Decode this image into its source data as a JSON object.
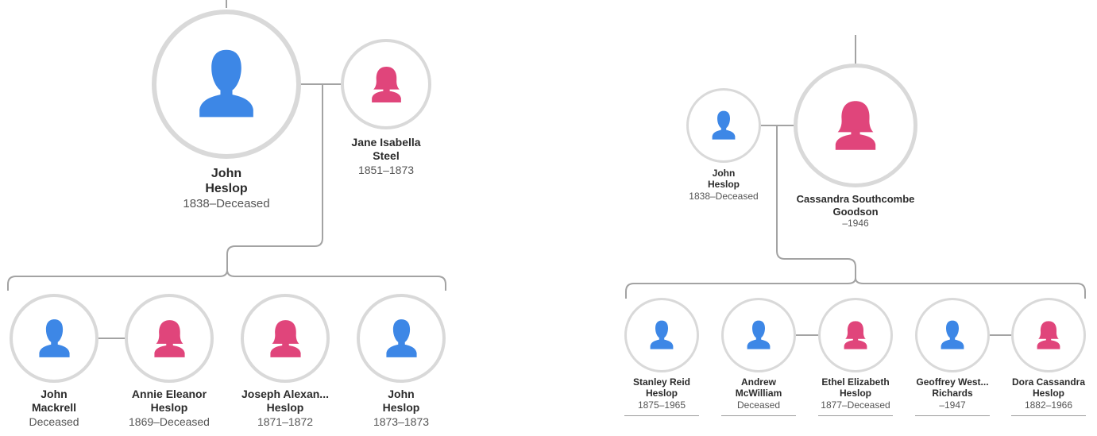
{
  "colors": {
    "male": "#3d87e6",
    "female": "#e0457b",
    "ring": "#d9d9d9",
    "line": "#a3a3a3"
  },
  "left_tree": {
    "father": {
      "first": "John",
      "last": "Heslop",
      "dates": "1838–Deceased",
      "gender": "male",
      "icon": "male-person-icon"
    },
    "mother": {
      "first": "Jane Isabella",
      "last": "Steel",
      "dates": "1851–1873",
      "gender": "female",
      "icon": "female-person-icon"
    },
    "children": [
      {
        "first": "John",
        "last": "Mackrell",
        "dates": "Deceased",
        "gender": "male",
        "icon": "male-person-icon"
      },
      {
        "first": "Annie Eleanor",
        "last": "Heslop",
        "dates": "1869–Deceased",
        "gender": "female",
        "icon": "female-person-icon"
      },
      {
        "first": "Joseph Alexan...",
        "last": "Heslop",
        "dates": "1871–1872",
        "gender": "female",
        "icon": "female-person-icon"
      },
      {
        "first": "John",
        "last": "Heslop",
        "dates": "1873–1873",
        "gender": "male",
        "icon": "male-person-icon"
      }
    ]
  },
  "right_tree": {
    "father": {
      "first": "John",
      "last": "Heslop",
      "dates": "1838–Deceased",
      "gender": "male",
      "icon": "male-person-icon"
    },
    "mother": {
      "first": "Cassandra Southcombe",
      "last": "Goodson",
      "dates": "–1946",
      "gender": "female",
      "icon": "female-person-icon"
    },
    "children": [
      {
        "first": "Stanley Reid",
        "last": "Heslop",
        "dates": "1875–1965",
        "gender": "male",
        "icon": "male-person-icon"
      },
      {
        "first": "Andrew",
        "last": "McWilliam",
        "dates": "Deceased",
        "gender": "male",
        "icon": "male-person-icon"
      },
      {
        "first": "Ethel Elizabeth",
        "last": "Heslop",
        "dates": "1877–Deceased",
        "gender": "female",
        "icon": "female-person-icon"
      },
      {
        "first": "Geoffrey West...",
        "last": "Richards",
        "dates": "–1947",
        "gender": "male",
        "icon": "male-person-icon"
      },
      {
        "first": "Dora Cassandra",
        "last": "Heslop",
        "dates": "1882–1966",
        "gender": "female",
        "icon": "female-person-icon"
      }
    ]
  }
}
